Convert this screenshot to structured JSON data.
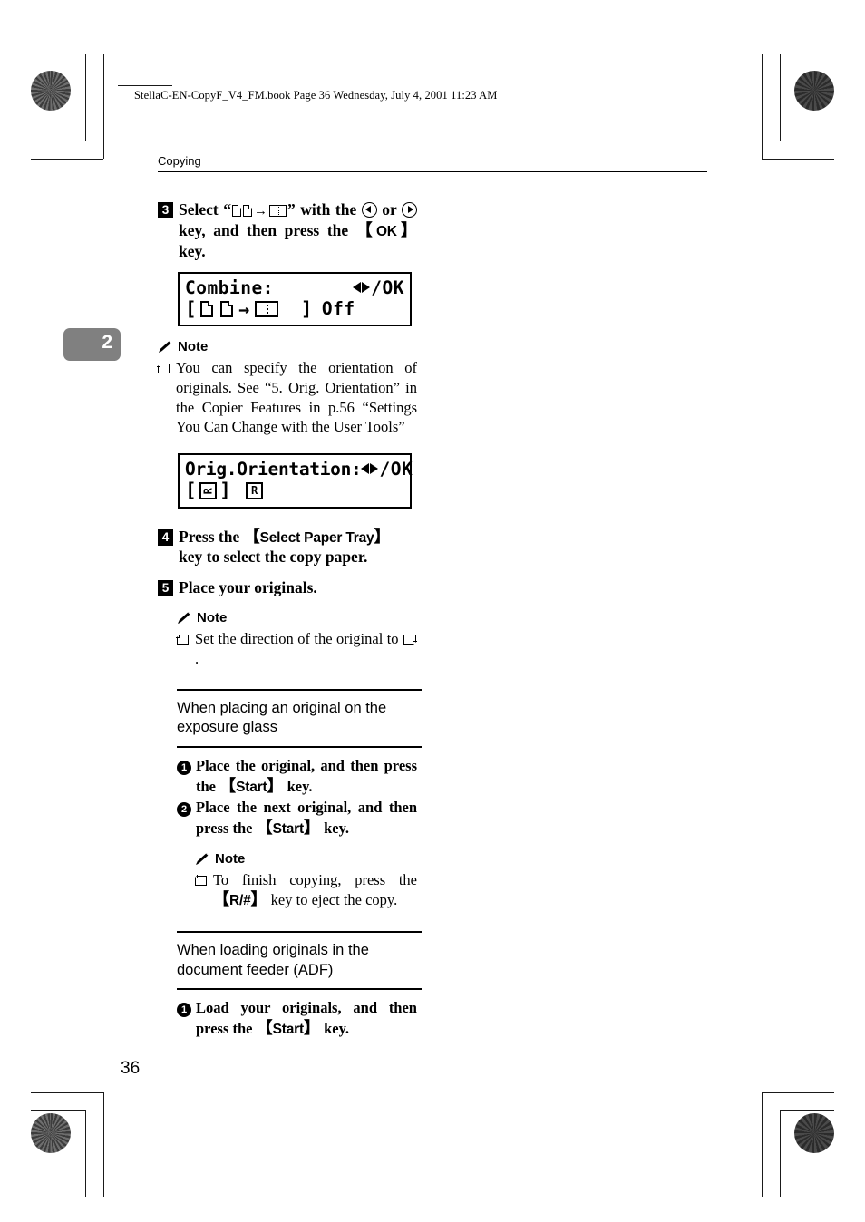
{
  "page": {
    "file_header": "StellaC-EN-CopyF_V4_FM.book  Page 36  Wednesday, July 4, 2001  11:23 AM",
    "running_head": "Copying",
    "chapter_tab": "2",
    "folio": "36"
  },
  "steps": [
    {
      "num": "3",
      "text_before": "Select “",
      "text_middle": "” with the ",
      "text_or": " or ",
      "text_after": " key, and then press the ",
      "key_ok": "OK",
      "text_end": " key."
    },
    {
      "num": "4",
      "line1_a": "Press the ",
      "key": "Select Paper Tray",
      "line1_b": " key to select the copy paper."
    },
    {
      "num": "5",
      "line1_a": "Place your originals."
    }
  ],
  "lcd_combine": {
    "title": "Combine:",
    "ok_label": "/OK",
    "bracket_open": "[",
    "bracket_close": "]",
    "value": "Off"
  },
  "lcd_orientation": {
    "title": "Orig.Orientation:",
    "ok_label": "/OK",
    "bracket_open": "[",
    "bracket_close": "]",
    "glyph_1": "R",
    "glyph_2": "R"
  },
  "note_orientation": {
    "label": "Note",
    "text": "You can specify the orientation of originals. See “5. Orig. Orientation” in the Copier Features in p.56 “Settings You Can Change with the User Tools”"
  },
  "note_direction": {
    "label": "Note",
    "text_a": "Set the direction of the original to ",
    "text_b": "."
  },
  "section_exposure_glass": {
    "title": "When placing an original on the exposure glass",
    "substeps": [
      {
        "num": "1",
        "text_a": "Place the original, and then press the ",
        "key": "Start",
        "text_b": " key."
      },
      {
        "num": "2",
        "text_a": "Place the next original, and then press the ",
        "key": "Start",
        "text_b": " key."
      }
    ],
    "note": {
      "label": "Note",
      "text_a": "To finish copying, press the ",
      "key": "R/#",
      "text_b": " key to eject the copy."
    }
  },
  "section_adf": {
    "title": "When loading originals in the document feeder (ADF)",
    "substeps": [
      {
        "num": "1",
        "text_a": "Load your originals, and then press the ",
        "key": "Start",
        "text_b": " key."
      }
    ]
  },
  "icons": {
    "pencil": "pencil-icon",
    "arrow_left_key": "arrow-left-circle-icon",
    "arrow_right_key": "arrow-right-circle-icon",
    "page_glyph": "page-icon",
    "sheet_glyph": "combined-sheet-icon",
    "landscape_glyph": "landscape-original-icon"
  },
  "colors": {
    "chapter_tab_bg": "#808080",
    "ink": "#000000",
    "paper": "#ffffff"
  }
}
